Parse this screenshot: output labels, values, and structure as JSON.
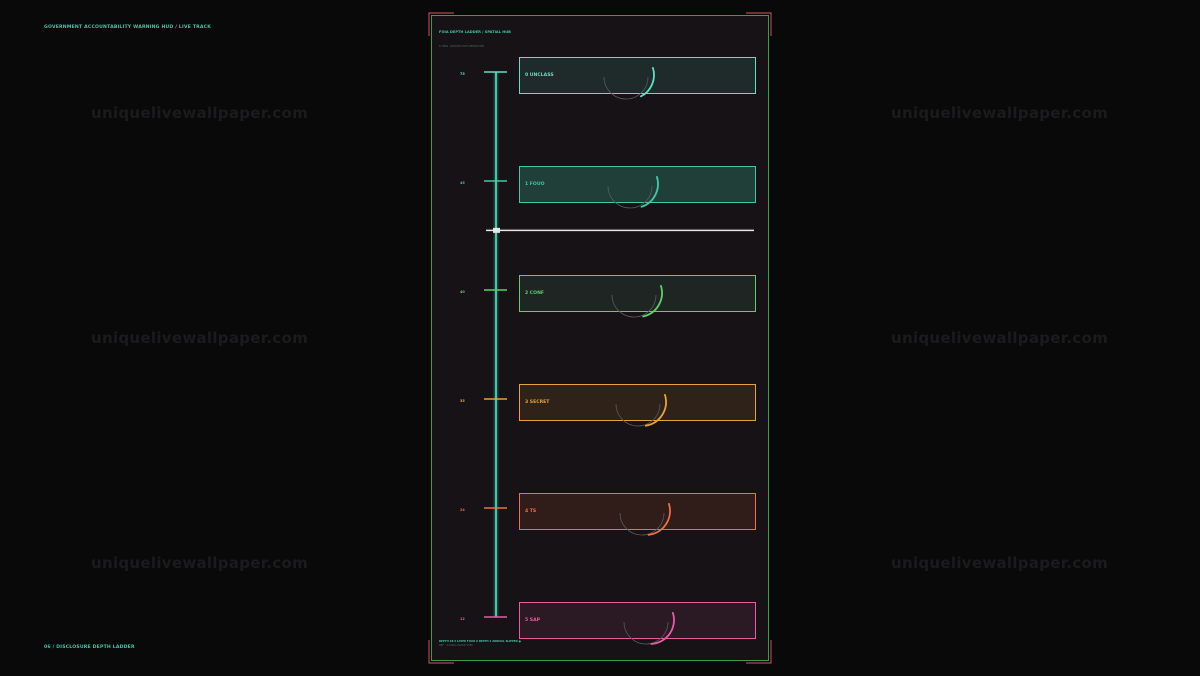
{
  "header": {
    "hud_title": "GOVERNMENT ACCOUNTABILITY WARNING HUD  /  LIVE TRACK"
  },
  "footer": {
    "caption": "06 / DISCLOSURE DEPTH LADDER"
  },
  "watermark": {
    "text": "uniquelivewallpaper.com"
  },
  "panel": {
    "title": "FOIA DEPTH LADDER  /  SPATIAL HUB",
    "subtitle": "6 TIERS · REQUEST PATH RESTRICTED",
    "footer_line1": "DEPTH 28.5   LAYER FOUO   6 DEPTH 2   ARRIVAL   SLIPPED ●",
    "footer_line2": "REF · 2-DISCLOSURE STEP"
  },
  "colors": {
    "background": "#0a0909",
    "panel_border": "#3c9b4f",
    "rail": "#3fc7a8",
    "cursor": "#e6e6e6"
  },
  "tiers": [
    {
      "label": "0  UNCLASS",
      "depth": "75",
      "color": "#5ee0c4",
      "fill": "#1f2a2b",
      "arc_progress": 0.35
    },
    {
      "label": "1  FOUO",
      "depth": "45",
      "color": "#3fc7a8",
      "fill": "#213f39",
      "arc_progress": 0.5
    },
    {
      "label": "2  CONF",
      "depth": "40",
      "color": "#5bcf6a",
      "fill": "#1f2523",
      "arc_progress": 0.6
    },
    {
      "label": "3  SECRET",
      "depth": "35",
      "color": "#e8a23c",
      "fill": "#2f2218",
      "arc_progress": 0.65
    },
    {
      "label": "4  TS",
      "depth": "24",
      "color": "#f07040",
      "fill": "#301c18",
      "arc_progress": 0.7
    },
    {
      "label": "5  SAP",
      "depth": "12",
      "color": "#e85aa8",
      "fill": "#2b1924",
      "arc_progress": 0.75
    }
  ],
  "cursor": {
    "between_tiers": [
      1,
      2
    ],
    "fraction": 0.38
  }
}
